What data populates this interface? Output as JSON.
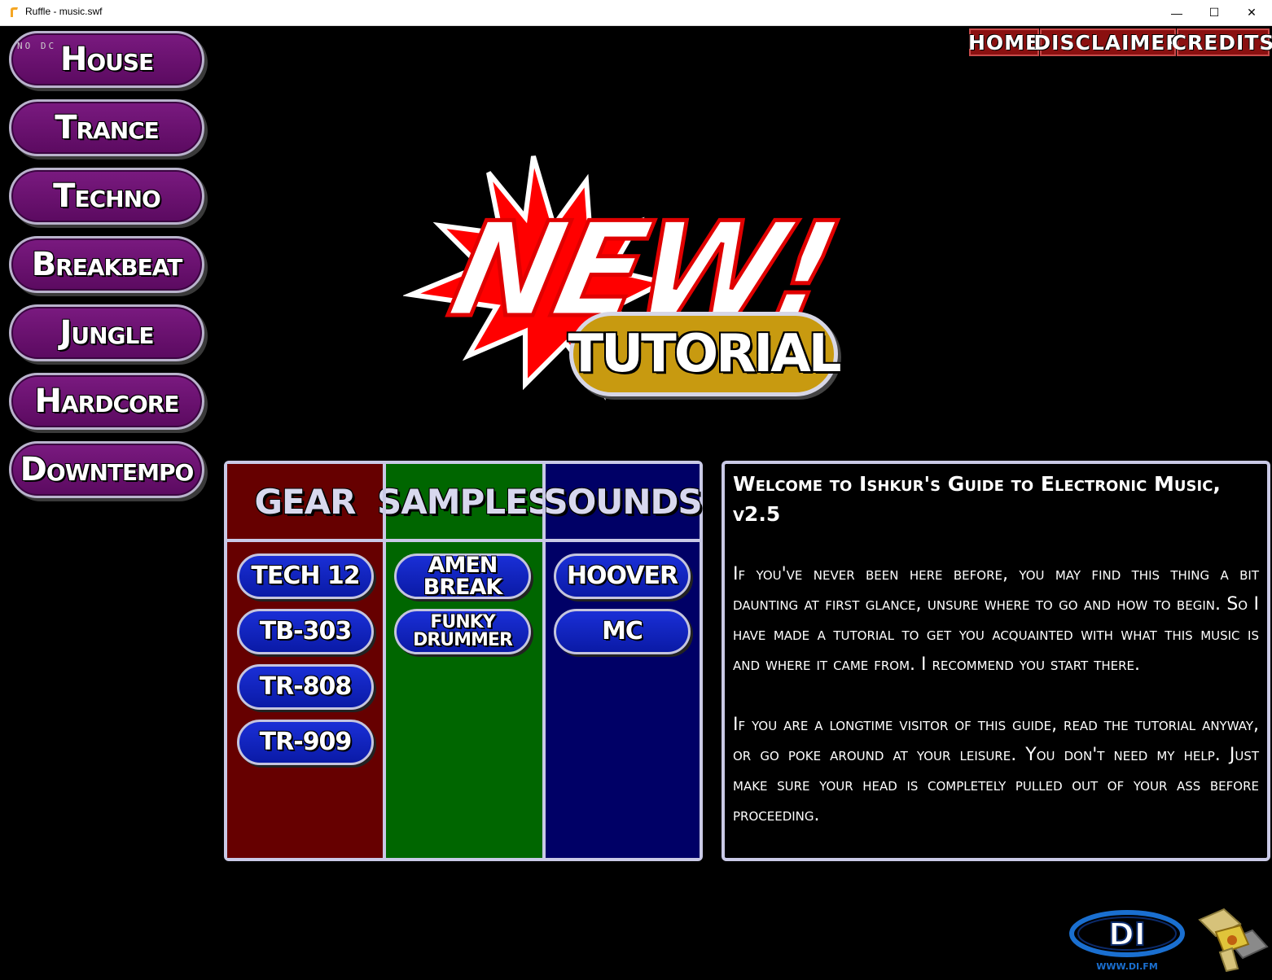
{
  "window": {
    "title": "Ruffle - music.swf",
    "minimize_symbol": "—",
    "maximize_symbol": "☐",
    "close_symbol": "✕"
  },
  "overlay_text": "NO DC",
  "genres": [
    "House",
    "Trance",
    "Techno",
    "Breakbeat",
    "Jungle",
    "Hardcore",
    "Downtempo"
  ],
  "topnav": {
    "home": "HOME",
    "disclaimer": "DISCLAIMER",
    "credits": "CREDITS"
  },
  "logo": {
    "new_text": "NEW!",
    "tutorial_text": "TUTORIAL"
  },
  "columns": {
    "gear": {
      "title": "GEAR",
      "items": [
        "TECH 12",
        "TB-303",
        "TR-808",
        "TR-909"
      ]
    },
    "samples": {
      "title": "SAMPLES",
      "items": [
        "AMEN BREAK",
        "FUNKY DRUMMER"
      ]
    },
    "sounds": {
      "title": "SOUNDS",
      "items": [
        "HOOVER",
        "MC"
      ]
    }
  },
  "welcome": {
    "title": "Welcome to Ishkur's Guide to Electronic Music, v2.5",
    "para1": "If you've never been here before, you may find this thing a bit daunting at first glance, unsure where to go and how to begin. So I have made a tutorial to get you acquainted with what this music is and where it came from. I recommend you start there.",
    "para2": "If you are a longtime visitor of this guide, read the tutorial anyway, or go poke around at your leisure. You don't need my help. Just make sure your head is completely pulled out of your ass before proceeding."
  },
  "di_logo": {
    "text": "DI",
    "url_text": "WWW.DI.FM"
  },
  "colors": {
    "genre_purple": "#6a1070",
    "gear_red": "#660000",
    "samples_green": "#006600",
    "sounds_blue": "#000066",
    "pill_blue": "#1428c8",
    "tutorial_gold": "#c89a10",
    "nav_red": "#8a1010"
  }
}
